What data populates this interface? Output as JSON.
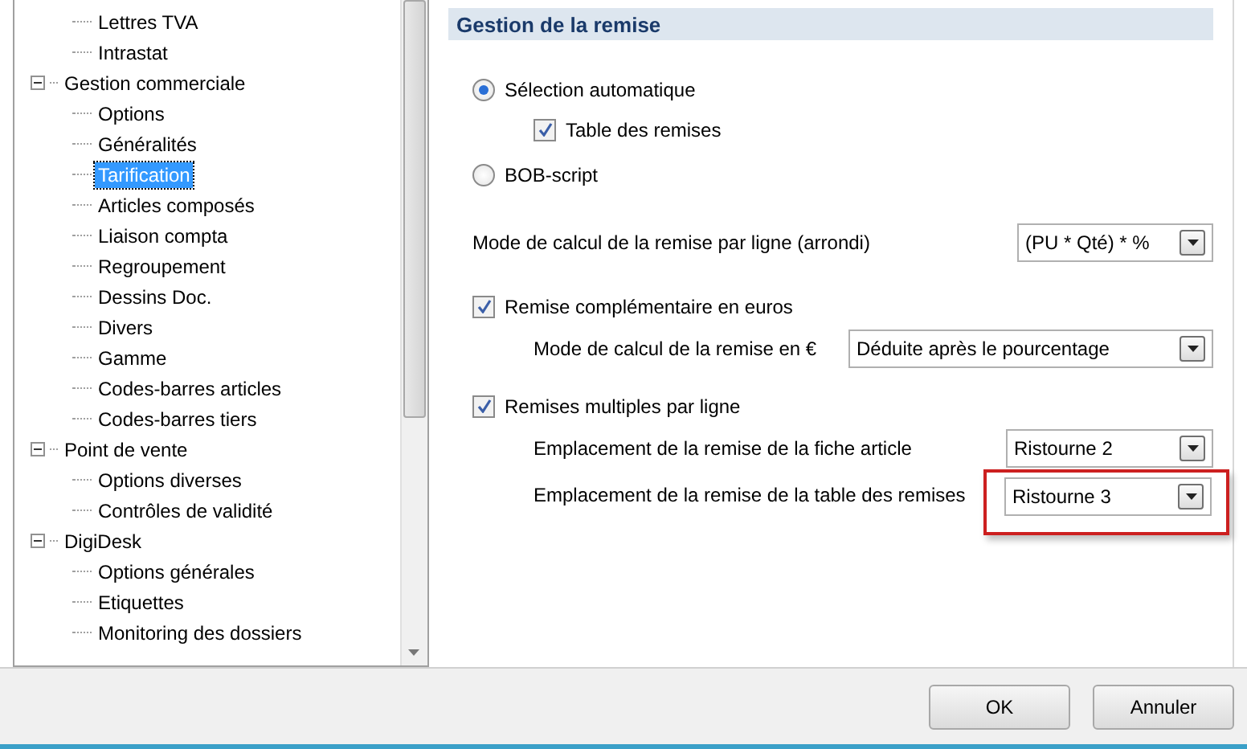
{
  "tree": {
    "items": [
      {
        "children": [
          {
            "label": "Lettres TVA",
            "selected": false
          },
          {
            "label": "Intrastat",
            "selected": false
          }
        ]
      },
      {
        "label": "Gestion commerciale",
        "expanded": true,
        "selected": false,
        "children": [
          {
            "label": "Options",
            "selected": false
          },
          {
            "label": "Généralités",
            "selected": false
          },
          {
            "label": "Tarification",
            "selected": true
          },
          {
            "label": "Articles composés",
            "selected": false
          },
          {
            "label": "Liaison compta",
            "selected": false
          },
          {
            "label": "Regroupement",
            "selected": false
          },
          {
            "label": "Dessins Doc.",
            "selected": false
          },
          {
            "label": "Divers",
            "selected": false
          },
          {
            "label": "Gamme",
            "selected": false
          },
          {
            "label": "Codes-barres articles",
            "selected": false
          },
          {
            "label": "Codes-barres tiers",
            "selected": false
          }
        ]
      },
      {
        "label": "Point de vente",
        "expanded": true,
        "selected": false,
        "children": [
          {
            "label": "Options diverses",
            "selected": false
          },
          {
            "label": "Contrôles de validité",
            "selected": false
          }
        ]
      },
      {
        "label": "DigiDesk",
        "expanded": true,
        "selected": false,
        "children": [
          {
            "label": "Options générales",
            "selected": false
          },
          {
            "label": "Etiquettes",
            "selected": false
          },
          {
            "label": "Monitoring des dossiers",
            "selected": false
          }
        ]
      }
    ]
  },
  "panel": {
    "title": "Gestion de la remise",
    "settings": [
      {
        "kind": "radio",
        "label": "Sélection automatique",
        "selected": true,
        "children": [
          {
            "kind": "checkbox",
            "label": "Table des remises",
            "checked": true
          }
        ]
      },
      {
        "kind": "radio",
        "label": "BOB-script",
        "selected": false
      },
      {
        "kind": "select",
        "label": "Mode de calcul de la remise par ligne (arrondi)",
        "value": "(PU * Qté) * %",
        "highlighted": false
      },
      {
        "kind": "checkbox",
        "label": "Remise complémentaire en euros",
        "checked": true,
        "children": [
          {
            "kind": "select",
            "label": "Mode de calcul de la remise en €",
            "value": "Déduite après le pourcentage",
            "highlighted": false
          }
        ]
      },
      {
        "kind": "checkbox",
        "label": "Remises multiples par ligne",
        "checked": true,
        "children": [
          {
            "kind": "select",
            "label": "Emplacement de la remise de la fiche article",
            "value": "Ristourne 2",
            "highlighted": false
          },
          {
            "kind": "select",
            "label": "Emplacement de la remise de la table des remises",
            "value": "Ristourne 3",
            "highlighted": true
          }
        ]
      }
    ]
  },
  "buttons": [
    {
      "label": "OK"
    },
    {
      "label": "Annuler"
    }
  ]
}
